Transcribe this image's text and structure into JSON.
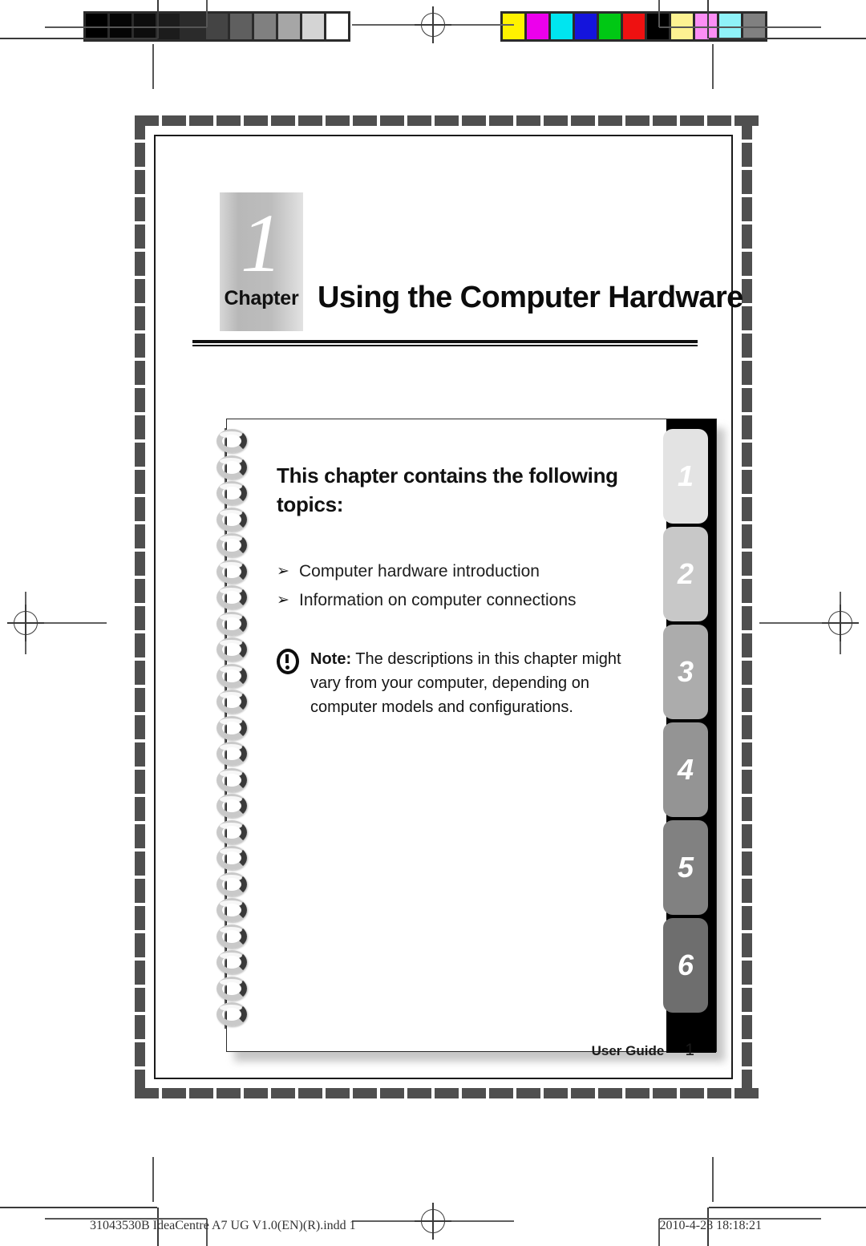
{
  "document": {
    "chapter_label": "Chapter",
    "chapter_number": "1",
    "chapter_title": "Using the Computer Hardware",
    "page_number": "1",
    "footer_label": "User Guide"
  },
  "card": {
    "heading": "This chapter contains the following topics:",
    "topics": [
      {
        "bullet": "➢",
        "text": "Computer hardware introduction"
      },
      {
        "bullet": "➢",
        "text": "Information on computer connections"
      }
    ],
    "note": {
      "icon": "exclamation-circle-icon",
      "label": "Note:",
      "text": " The descriptions in this chapter might vary from your computer, depending on computer models and configurations."
    },
    "tabs": [
      {
        "number": "1",
        "color": "#e3e3e3"
      },
      {
        "number": "2",
        "color": "#c8c8c8"
      },
      {
        "number": "3",
        "color": "#acacac"
      },
      {
        "number": "4",
        "color": "#949494"
      },
      {
        "number": "5",
        "color": "#818181"
      },
      {
        "number": "6",
        "color": "#6e6e6e"
      }
    ]
  },
  "print_marks": {
    "slug_left": "31043530B IdeaCentre A7 UG V1.0(EN)(R).indd   1",
    "slug_right": "2010-4-28   18:18:21",
    "grayscale_strip": [
      "#000000",
      "#050505",
      "#0d0d0d",
      "#1c1c1c",
      "#2b2b2b",
      "#444444",
      "#5f5f5f",
      "#808080",
      "#a6a6a6",
      "#d4d4d4",
      "#ffffff"
    ],
    "color_strip": [
      "#fff200",
      "#ec00ec",
      "#00e5f0",
      "#1414dc",
      "#00c814",
      "#ee1111",
      "#000000",
      "#fdf292",
      "#fc8ef5",
      "#8ff2f8",
      "#808080"
    ]
  }
}
